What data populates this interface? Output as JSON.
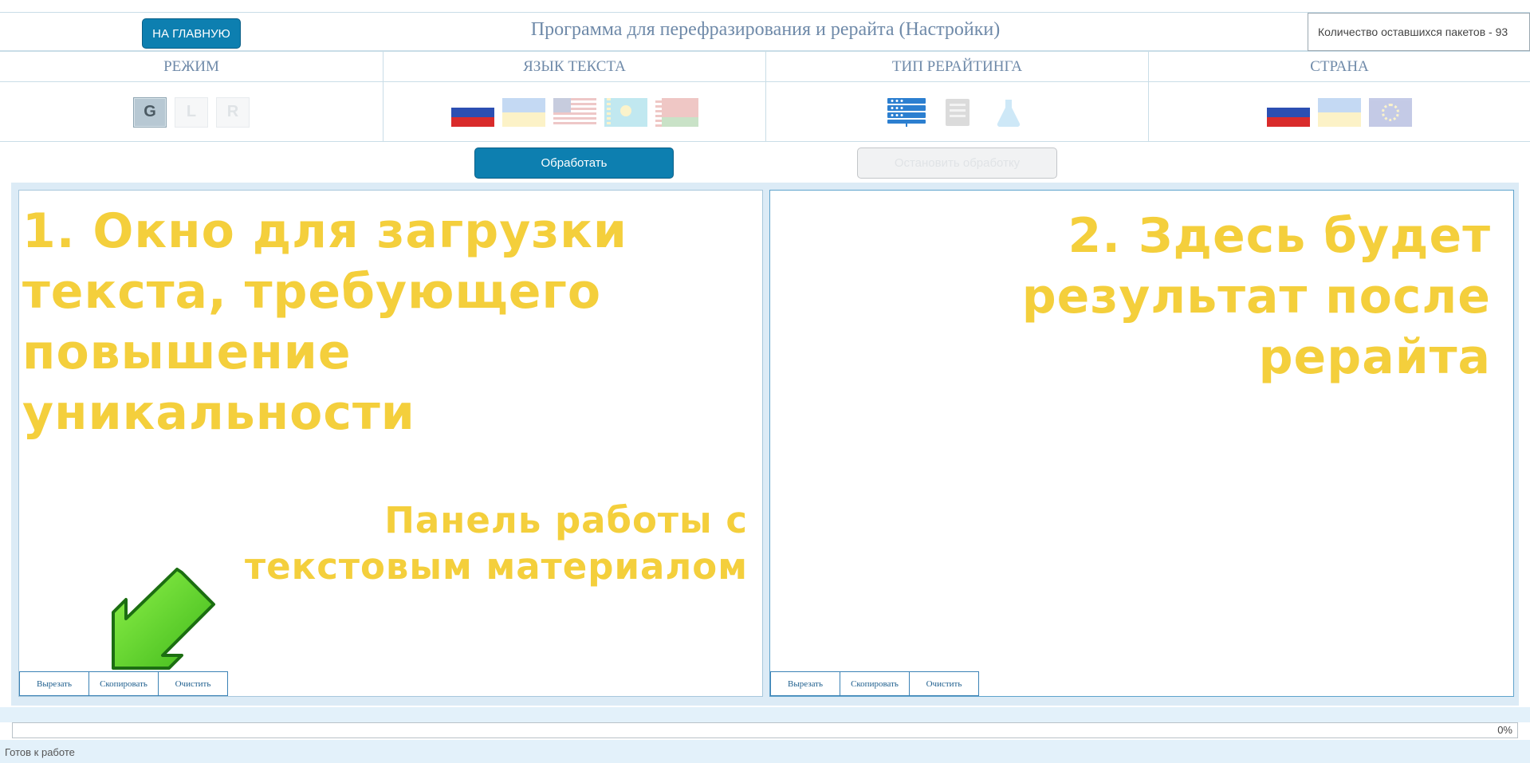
{
  "header": {
    "home_label": "НА ГЛАВНУЮ",
    "title": "Программа для перефразирования и рерайта (Настройки)",
    "packets": "Количество оставшихся пакетов - 93"
  },
  "settings": {
    "mode": {
      "heading": "РЕЖИМ",
      "options": [
        "G",
        "L",
        "R"
      ],
      "selected": "G"
    },
    "language": {
      "heading": "ЯЗЫК ТЕКСТА",
      "flags": [
        "russia-flag-icon",
        "ukraine-flag-icon",
        "usa-flag-icon",
        "kazakhstan-flag-icon",
        "belarus-flag-icon"
      ],
      "selected": "russia-flag-icon"
    },
    "rewrite_type": {
      "heading": "ТИП РЕРАЙТИНГА",
      "icons": [
        "server-icon",
        "document-icon",
        "flask-icon"
      ],
      "selected": "server-icon"
    },
    "country": {
      "heading": "СТРАНА",
      "flags": [
        "russia-flag-icon",
        "ukraine-flag-icon",
        "eu-flag-icon"
      ],
      "selected": "russia-flag-icon"
    }
  },
  "actions": {
    "process_label": "Обработать",
    "stop_label": "Остановить обработку"
  },
  "left_pane": {
    "tools": [
      "Вырезать",
      "Скопировать",
      "Очистить"
    ]
  },
  "right_pane": {
    "tools": [
      "Вырезать",
      "Скопировать",
      "Очистить"
    ]
  },
  "annotations": {
    "input_window": "1. Окно для загрузки текста, требующего повышение уникальности",
    "result_window": "2. Здесь будет результат после рерайта",
    "text_panel": "Панель работы с текстовым материалом"
  },
  "progress": {
    "value": 0,
    "label": "0%"
  },
  "status": {
    "text": "Готов к работе"
  },
  "colors": {
    "accent": "#0d7fb0",
    "annotation": "#f4cf3c",
    "arrow": "#4ccd1e"
  }
}
